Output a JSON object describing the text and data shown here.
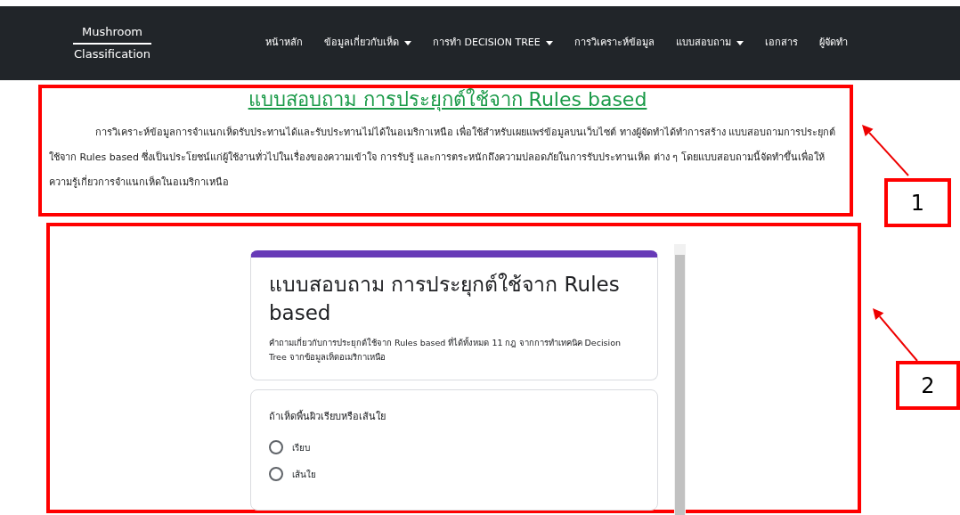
{
  "navbar": {
    "brand_top": "Mushroom",
    "brand_bottom": "Classification",
    "items": [
      {
        "label": "หน้าหลัก",
        "dropdown": false
      },
      {
        "label": "ข้อมูลเกี่ยวกับเห็ด",
        "dropdown": true
      },
      {
        "label": "การทำ DECISION TREE",
        "dropdown": true
      },
      {
        "label": "การวิเคราะห์ข้อมูล",
        "dropdown": false
      },
      {
        "label": "แบบสอบถาม",
        "dropdown": true
      },
      {
        "label": "เอกสาร",
        "dropdown": false
      },
      {
        "label": "ผู้จัดทำ",
        "dropdown": false
      }
    ]
  },
  "intro": {
    "title": "แบบสอบถาม การประยุกต์ใช้จาก Rules based",
    "paragraph": "การวิเคราะห์ข้อมูลการจำแนกเห็ดรับประทานได้และรับประทานไม่ได้ในอเมริกาเหนือ เพื่อใช้สำหรับเผยแพร่ข้อมูลบนเว็บไซต์ ทางผู้จัดทำได้ทำการสร้าง แบบสอบถามการประยุกต์ใช้จาก Rules based ซึ่งเป็นประโยชน์แก่ผู้ใช้งานทั่วไปในเรื่องของความเข้าใจ การรับรู้ และการตระหนักถึงความปลอดภัยในการรับประทานเห็ด ต่าง ๆ โดยแบบสอบถามนี้จัดทำขึ้นเพื่อให้ความรู้เกี่ยวการจำแนกเห็ดในอเมริกาเหนือ"
  },
  "form": {
    "title": "แบบสอบถาม การประยุกต์ใช้จาก Rules based",
    "description": "คำถามเกี่ยวกับการประยุกต์ใช้จาก Rules based ที่ได้ทั้งหมด 11 กฎ จากการทำเทคนิค Decision Tree จากข้อมูลเห็ดอเมริกาเหนือ",
    "questions": [
      {
        "text": "ถ้าเห็ดพื้นผิวเรียบหรือเส้นใย",
        "options": [
          {
            "label": "เรียบ",
            "selected": false
          },
          {
            "label": "เส้นใย",
            "selected": false
          }
        ]
      }
    ]
  },
  "annotations": [
    {
      "label": "1"
    },
    {
      "label": "2"
    }
  ]
}
